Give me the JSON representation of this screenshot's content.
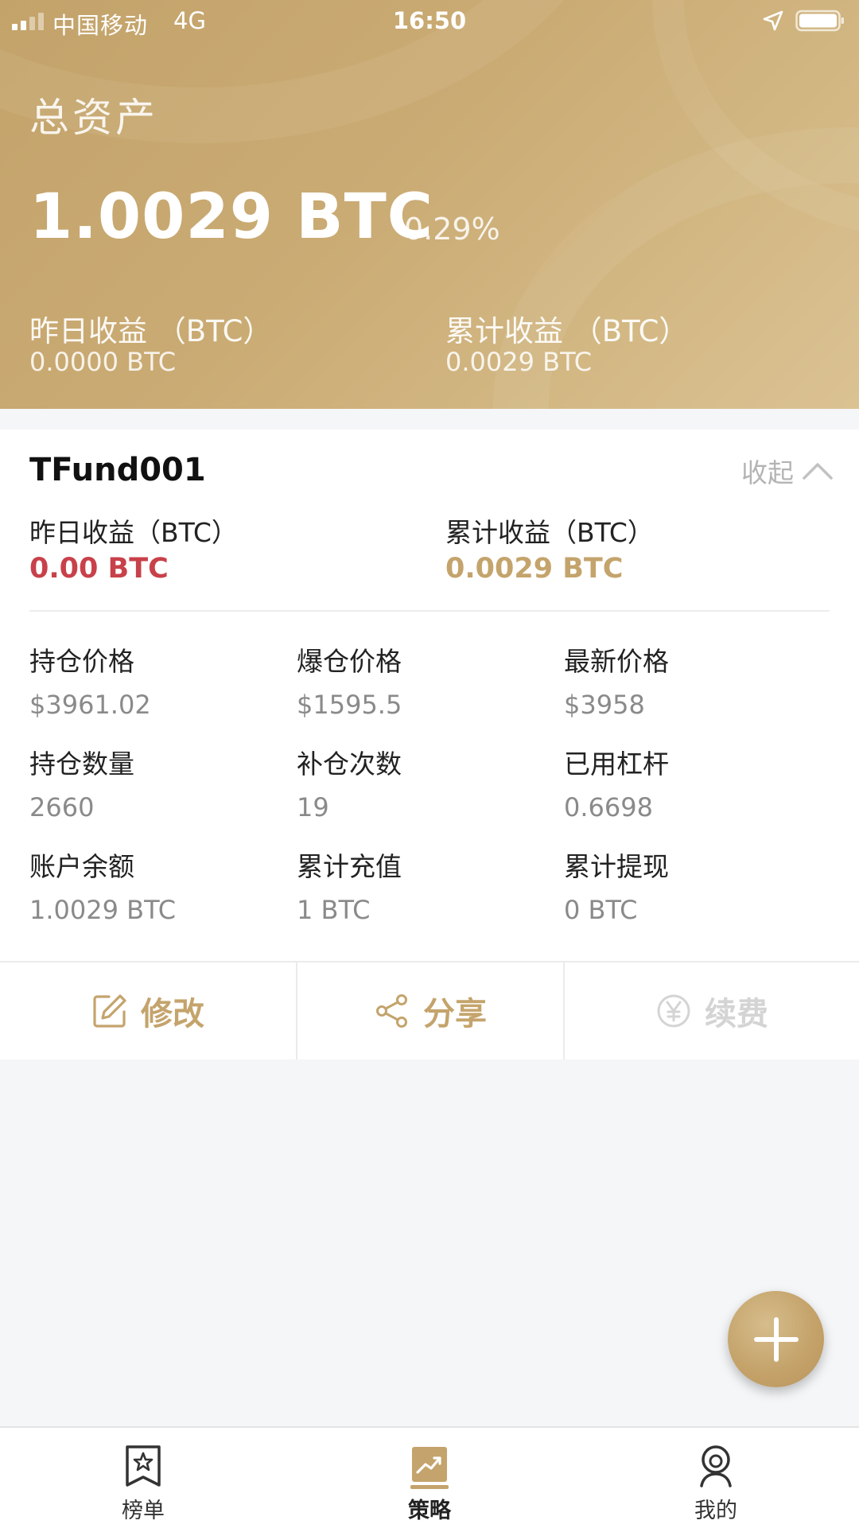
{
  "status_bar": {
    "carrier": "中国移动",
    "network": "4G",
    "time": "16:50"
  },
  "summary": {
    "title": "总资产",
    "total": "1.0029 BTC",
    "change": "0.29%",
    "yesterday_label": "昨日收益 （BTC）",
    "yesterday_value": "0.0000 BTC",
    "cumulative_label": "累计收益 （BTC）",
    "cumulative_value": "0.0029 BTC"
  },
  "fund": {
    "name": "TFund001",
    "collapse_label": "收起",
    "yesterday_label": "昨日收益（BTC）",
    "yesterday_value": "0.00 BTC",
    "cumulative_label": "累计收益（BTC）",
    "cumulative_value": "0.0029 BTC",
    "stats": [
      {
        "label": "持仓价格",
        "value": "$3961.02"
      },
      {
        "label": "爆仓价格",
        "value": "$1595.5"
      },
      {
        "label": "最新价格",
        "value": "$3958"
      },
      {
        "label": "持仓数量",
        "value": "2660"
      },
      {
        "label": "补仓次数",
        "value": "19"
      },
      {
        "label": "已用杠杆",
        "value": "0.6698"
      },
      {
        "label": "账户余额",
        "value": "1.0029 BTC"
      },
      {
        "label": "累计充值",
        "value": "1 BTC"
      },
      {
        "label": "累计提现",
        "value": "0 BTC"
      }
    ],
    "actions": {
      "edit": "修改",
      "share": "分享",
      "renew": "续费"
    }
  },
  "tabbar": {
    "ranking": "榜单",
    "strategy": "策略",
    "mine": "我的"
  },
  "colors": {
    "gold": "#c4a46c",
    "red": "#c8414a",
    "header_gold": "#caab74"
  },
  "icons": [
    "signal-icon",
    "location-arrow-icon",
    "battery-icon",
    "chevron-up-icon",
    "edit-icon",
    "share-icon",
    "yen-icon",
    "plus-icon",
    "bookmark-star-icon",
    "trend-chart-icon",
    "user-icon"
  ]
}
